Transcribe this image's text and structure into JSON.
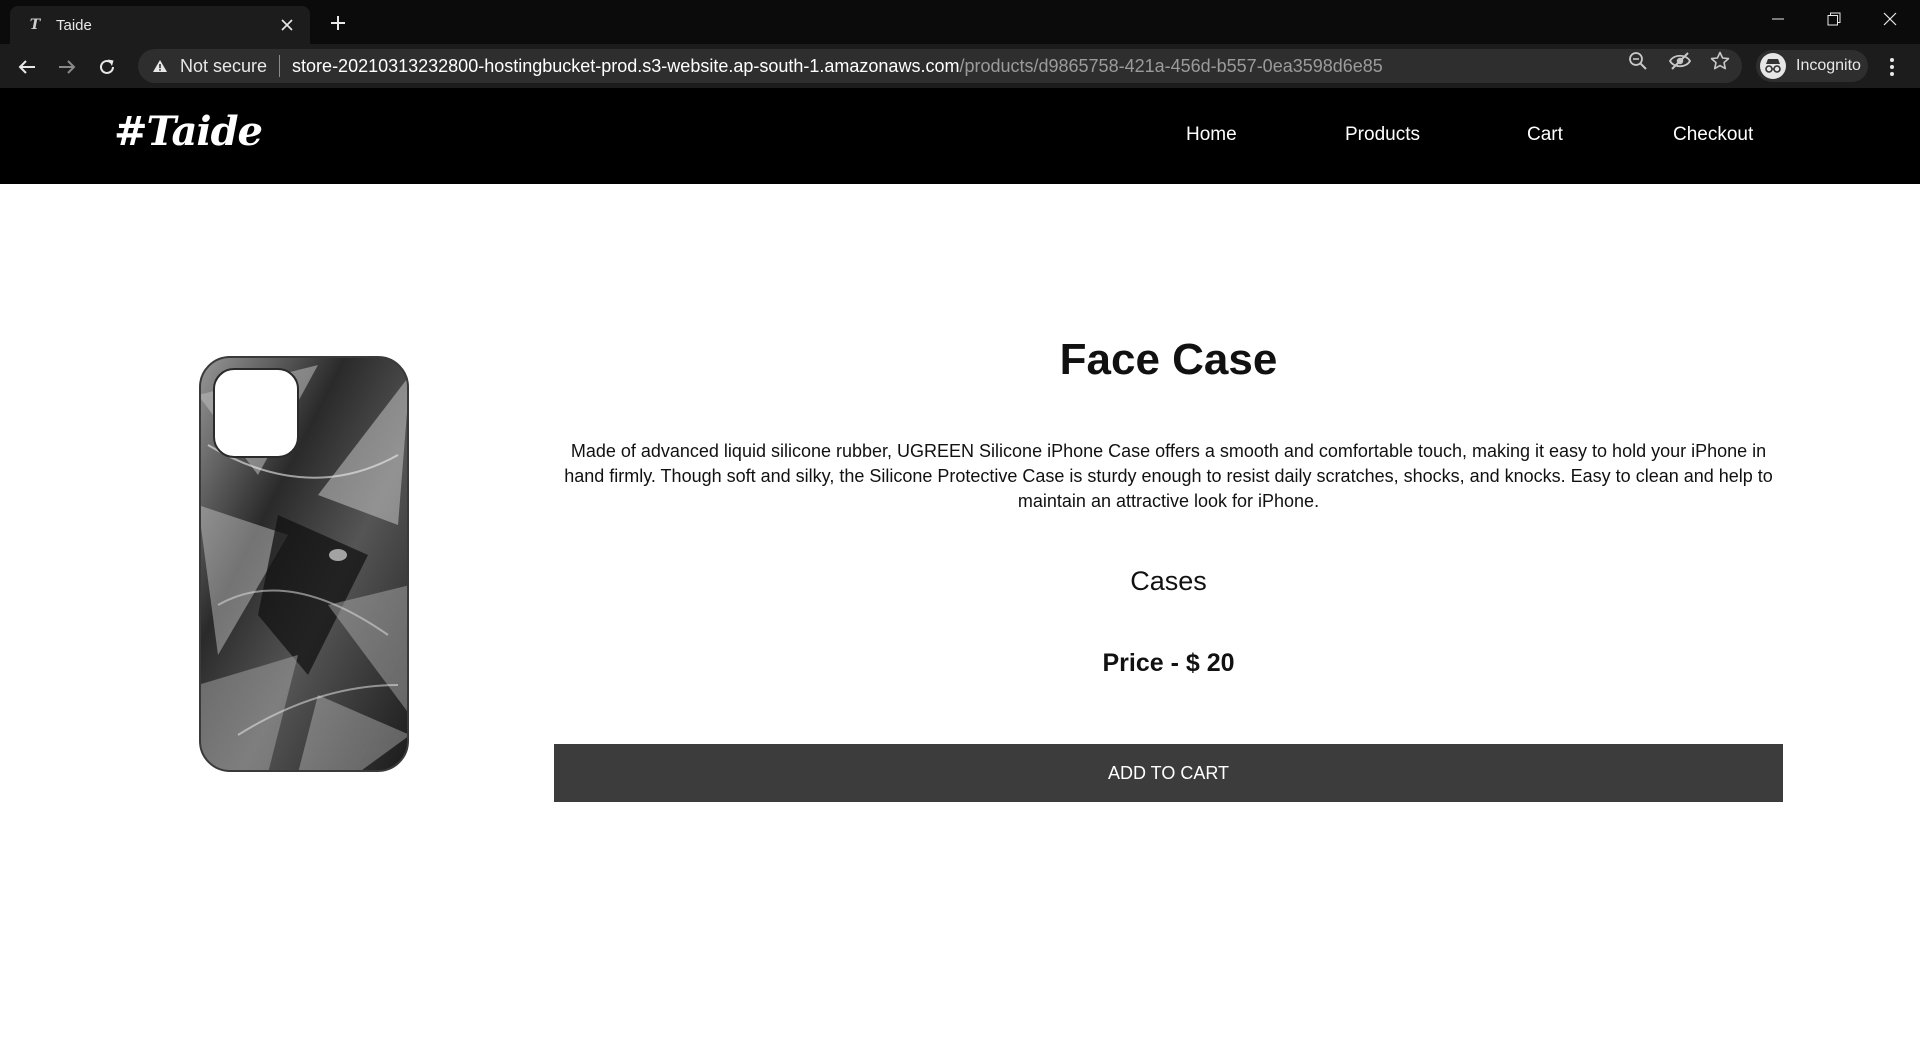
{
  "browser": {
    "tab_title": "Taide",
    "favicon_letter": "T",
    "security_label": "Not secure",
    "url_host": "store-20210313232800-hostingbucket-prod.s3-website.ap-south-1.amazonaws.com",
    "url_path": "/products/d9865758-421a-456d-b557-0ea3598d6e85",
    "profile_label": "Incognito"
  },
  "site": {
    "logo": "#Taide",
    "nav": [
      {
        "label": "Home"
      },
      {
        "label": "Products"
      },
      {
        "label": "Cart"
      },
      {
        "label": "Checkout"
      }
    ]
  },
  "product": {
    "title": "Face Case",
    "description": "Made of advanced liquid silicone rubber, UGREEN Silicone iPhone Case offers a smooth and comfortable touch, making it easy to hold your iPhone in hand firmly. Though soft and silky, the Silicone Protective Case is sturdy enough to resist daily scratches, shocks, and knocks. Easy to clean and help to maintain an attractive look for iPhone.",
    "category": "Cases",
    "price_label": "Price - $ 20",
    "add_to_cart_label": "ADD TO CART"
  },
  "colors": {
    "header_bg": "#000000",
    "button_bg": "#3c3c3c",
    "chrome_bg": "#1c1c1c"
  }
}
